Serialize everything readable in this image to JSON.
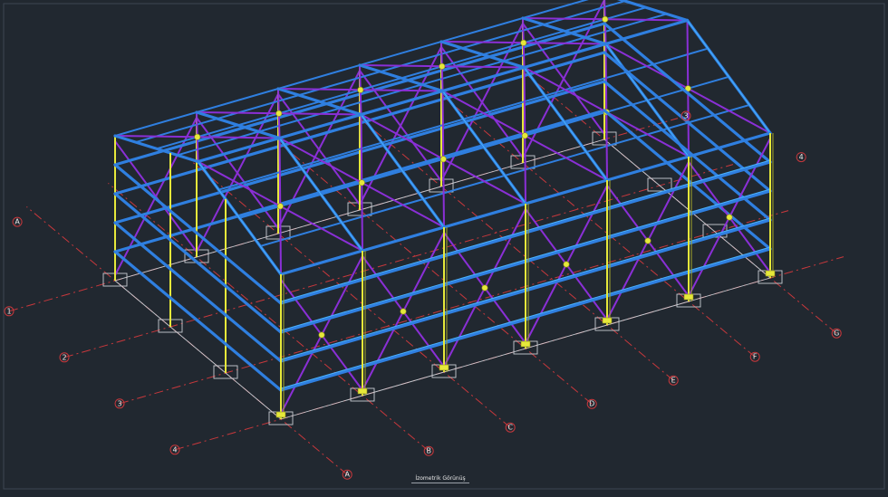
{
  "view_caption": "İzometrik Görünüş",
  "axis_labels_short_side": [
    "1",
    "2",
    "3",
    "4"
  ],
  "axis_labels_long_side": [
    "A",
    "B",
    "C",
    "D",
    "E",
    "F",
    "G"
  ],
  "far_axis_labels": [
    "A",
    "3",
    "4"
  ],
  "colors": {
    "background": "#212830",
    "beams": "#2f7fe0",
    "columns": "#e6e83a",
    "bracing": "#8a2fd6",
    "grid_axes": "#c8383c"
  }
}
